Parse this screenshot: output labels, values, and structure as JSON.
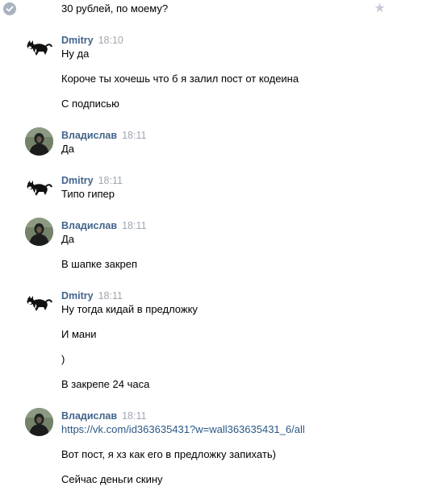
{
  "first_line": {
    "text": "30 рублей, по моему?"
  },
  "messages": [
    {
      "author": "Dmitry",
      "time": "18:10",
      "avatar": "cat-avatar",
      "lines": [
        "Ну да",
        "Короче ты хочешь что б я залил пост от кодеина",
        "С подписью"
      ]
    },
    {
      "author": "Владислав",
      "time": "18:11",
      "avatar": "person-avatar",
      "lines": [
        "Да"
      ]
    },
    {
      "author": "Dmitry",
      "time": "18:11",
      "avatar": "cat-avatar",
      "lines": [
        "Типо гипер"
      ]
    },
    {
      "author": "Владислав",
      "time": "18:11",
      "avatar": "person-avatar",
      "lines": [
        "Да",
        "В шапке закреп"
      ]
    },
    {
      "author": "Dmitry",
      "time": "18:11",
      "avatar": "cat-avatar",
      "lines": [
        "Ну тогда кидай в предложку",
        "И мани",
        ")",
        "В закрепе 24 часа"
      ]
    },
    {
      "author": "Владислав",
      "time": "18:11",
      "avatar": "person-avatar",
      "link": "https://vk.com/id363635431?w=wall363635431_6/all",
      "lines": [
        "Вот пост, я хз как его в предложку запихать)",
        "Сейчас деньги скину"
      ]
    }
  ],
  "icons": {
    "check": "check-circle-icon",
    "star": "star-icon"
  },
  "colors": {
    "author": "#42648b",
    "link": "#2a5885",
    "time": "#a0a7b0",
    "icon_gray": "#a9b3c0"
  }
}
